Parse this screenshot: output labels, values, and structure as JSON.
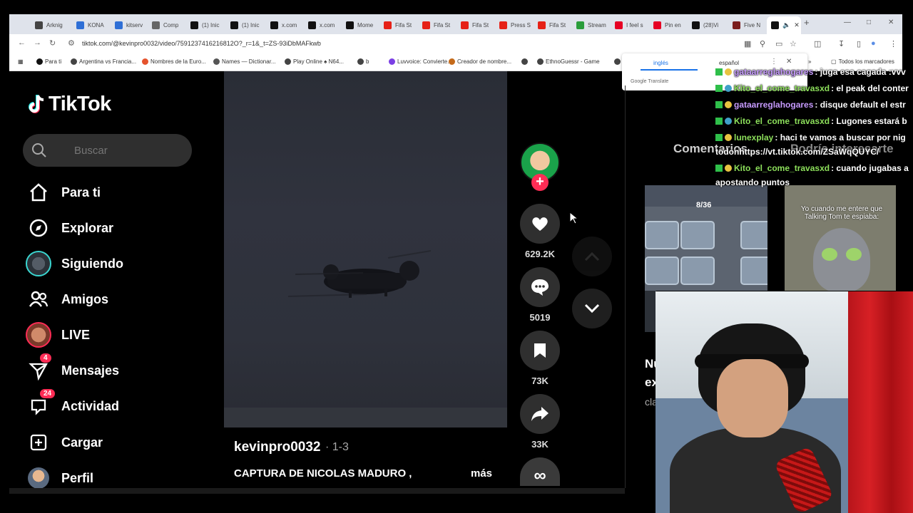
{
  "browser": {
    "tabs": [
      {
        "label": "Arknig",
        "color": "#444"
      },
      {
        "label": "KONA",
        "color": "#2e6fd6"
      },
      {
        "label": "kitserv",
        "color": "#2e6fd6"
      },
      {
        "label": "Comp",
        "color": "#666"
      },
      {
        "label": "(1) Inic",
        "color": "#111"
      },
      {
        "label": "(1) Inic",
        "color": "#111"
      },
      {
        "label": "x.com",
        "color": "#111"
      },
      {
        "label": "x.com",
        "color": "#111"
      },
      {
        "label": "Mome",
        "color": "#111"
      },
      {
        "label": "Fifa St",
        "color": "#e62117"
      },
      {
        "label": "Fifa St",
        "color": "#e62117"
      },
      {
        "label": "Fifa St",
        "color": "#e62117"
      },
      {
        "label": "Press S",
        "color": "#e62117"
      },
      {
        "label": "Fifa St",
        "color": "#e62117"
      },
      {
        "label": "Stream",
        "color": "#2a9d3b"
      },
      {
        "label": "I feel s",
        "color": "#e60023"
      },
      {
        "label": "Pin en",
        "color": "#e60023"
      },
      {
        "label": "(28)Vi",
        "color": "#111"
      },
      {
        "label": "Five N",
        "color": "#7a1d1d"
      }
    ],
    "url": "tiktok.com/@kevinpro0032/video/7591237416216812O?_r=1&_t=ZS-93iDbMAFkwb",
    "bookmarks": [
      "Para ti",
      "Argentina vs Francia...",
      "Nombres de la Euro...",
      "Names — Dictionar...",
      "Play Online ♠ N64...",
      "b",
      "Luvvoice: Convierte...",
      "Creador de nombre...",
      "",
      "EthnoGuessr - Game",
      "De"
    ],
    "all_bookmarks": "Todos los marcadores"
  },
  "translate": {
    "lang_from": "inglés",
    "lang_to": "español",
    "brand": "Google Translate"
  },
  "tiktok": {
    "logo": "TikTok",
    "search_placeholder": "Buscar",
    "nav": {
      "para_ti": "Para ti",
      "explorar": "Explorar",
      "siguiendo": "Siguiendo",
      "amigos": "Amigos",
      "live": "LIVE",
      "mensajes": "Mensajes",
      "mensajes_badge": "4",
      "actividad": "Actividad",
      "actividad_badge": "24",
      "cargar": "Cargar",
      "perfil": "Perfil"
    },
    "video": {
      "author": "kevinpro0032",
      "date": "· 1-3",
      "caption": "CAPTURA DE NICOLAS MADURO ,",
      "more": "más"
    },
    "actions": {
      "likes": "629.2K",
      "comments": "5019",
      "saves": "73K",
      "shares": "33K"
    },
    "panel": {
      "tab_comments": "Comentarios",
      "tab_more": "Podría interesarte",
      "thumb1_count": "8/36",
      "thumb2_text": "Yo cuando me entere que Talking Tom te espiaba:",
      "frag1": "Nu",
      "frag2": "ex",
      "frag3": "cla"
    }
  },
  "chat": [
    {
      "user": "gataarreglahogares",
      "text": ": juga esa cagada :vvv",
      "user_color": "#c79bff"
    },
    {
      "user": "Kito_el_come_travasxd",
      "text": ": el peak del conter",
      "user_color": "#8de05b"
    },
    {
      "user": "gataarreglahogares",
      "text": ": disque default el estr",
      "user_color": "#c79bff"
    },
    {
      "user": "Kito_el_come_travasxd",
      "text": ": Lugones estará b",
      "user_color": "#8de05b"
    },
    {
      "user": "lunexplay",
      "text": ": haci te vamos a buscar por nig",
      "user_color": "#8de05b"
    },
    {
      "user": "",
      "text": "todonhttps://vt.tiktok.com/ZSaWqQUYC/",
      "user_color": "#fff"
    },
    {
      "user": "Kito_el_come_travasxd",
      "text": ": cuando jugabas a",
      "user_color": "#8de05b"
    },
    {
      "user": "",
      "text": "apostando puntos",
      "user_color": "#fff"
    }
  ]
}
